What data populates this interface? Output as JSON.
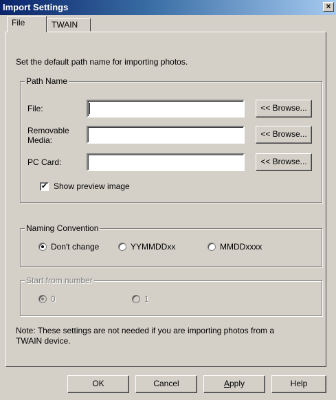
{
  "window": {
    "title": "Import Settings",
    "close": "×"
  },
  "tabs": [
    {
      "label": "File",
      "active": true
    },
    {
      "label": "TWAIN",
      "active": false
    }
  ],
  "intro": "Set the default path name for importing photos.",
  "path_group": {
    "legend": "Path Name",
    "file_label": "File:",
    "file_value": "",
    "removable_label_1": "Removable",
    "removable_label_2": "Media:",
    "removable_value": "",
    "pccard_label": "PC Card:",
    "pccard_value": "",
    "browse_label": "<< Browse..."
  },
  "preview": {
    "label": "Show preview image",
    "checked": true,
    "mark": "✔"
  },
  "naming_group": {
    "legend": "Naming Convention",
    "options": [
      "Don't change",
      "YYMMDDxx",
      "MMDDxxxx"
    ],
    "selected": 0
  },
  "start_group": {
    "legend": "Start from number",
    "options": [
      "0",
      "1"
    ],
    "selected": 0,
    "enabled": false
  },
  "note": {
    "line1": "Note:  These settings are not needed if you are importing photos from a",
    "line2": "TWAIN device."
  },
  "buttons": {
    "ok": "OK",
    "cancel": "Cancel",
    "apply_first": "A",
    "apply_rest": "pply",
    "help": "Help"
  }
}
